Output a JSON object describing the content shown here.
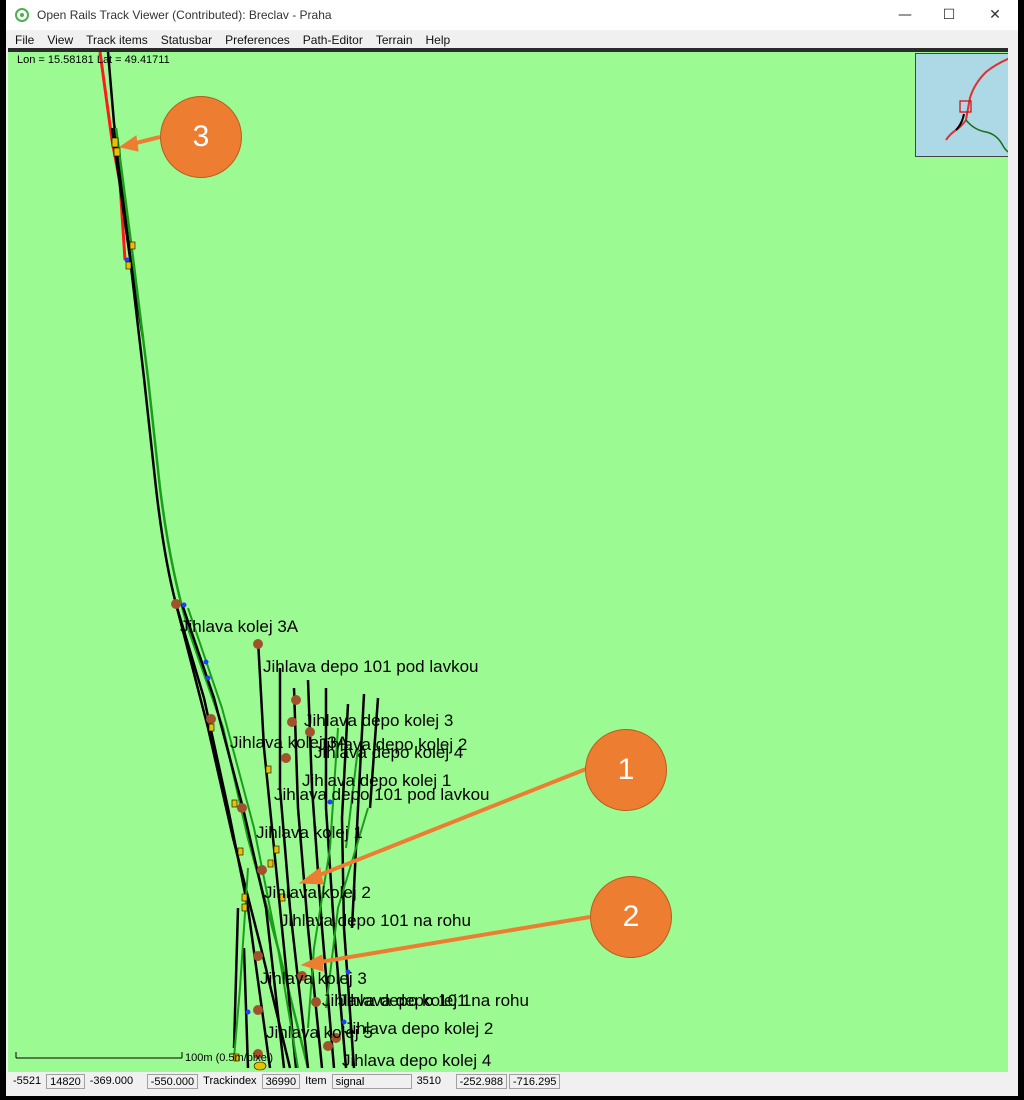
{
  "window": {
    "title": "Open Rails Track Viewer (Contributed): Breclav - Praha",
    "controls": {
      "minimize": "—",
      "maximize": "☐",
      "close": "✕"
    }
  },
  "menu": [
    "File",
    "View",
    "Track items",
    "Statusbar",
    "Preferences",
    "Path-Editor",
    "Terrain",
    "Help"
  ],
  "map": {
    "coords": "Lon = 15.58181   Lat = 49.41711",
    "scale_label": "100m (0.5m/pixel)",
    "labels": [
      "Jihlava kolej 3A",
      "Jihlava depo 101 pod lavkou",
      "Jihlava depo kolej 3",
      "Jihlava kolej 3A",
      "Jihlava depo kolej 2",
      "Jihlava depo kolej 4",
      "Jihlava depo kolej 1",
      "Jihlava depo 101 pod lavkou",
      "Jihlava kolej 1",
      "Jihlava kolej 2",
      "Jihlava depo 101 na rohu",
      "Jihlava kolej 3",
      "Jihlava depo 101 na rohu",
      "Jihlava depo kolej 1",
      "Jihlava depo kolej 2",
      "Jihlava kolej 5",
      "Jihlava depo kolej 4"
    ],
    "colors": {
      "background": "#9cfa93",
      "track": "#000000",
      "track_alt": "#1a9e1a",
      "path": "#ff1a1a",
      "junction": "#a0522d",
      "signal": "#1f3fff",
      "callout": "#ed7d31",
      "minimap": "#add8e6"
    }
  },
  "callouts": [
    "1",
    "2",
    "3"
  ],
  "statusbar": {
    "tile_x": "-5521",
    "tile_z": "14820",
    "x": "-369.000",
    "z": "-550.000",
    "trackindex_label": "Trackindex",
    "trackindex": "36990",
    "item_label": "Item",
    "item_type": "signal",
    "item_id": "3510",
    "item_x": "-252.988",
    "item_z": "-716.295"
  }
}
